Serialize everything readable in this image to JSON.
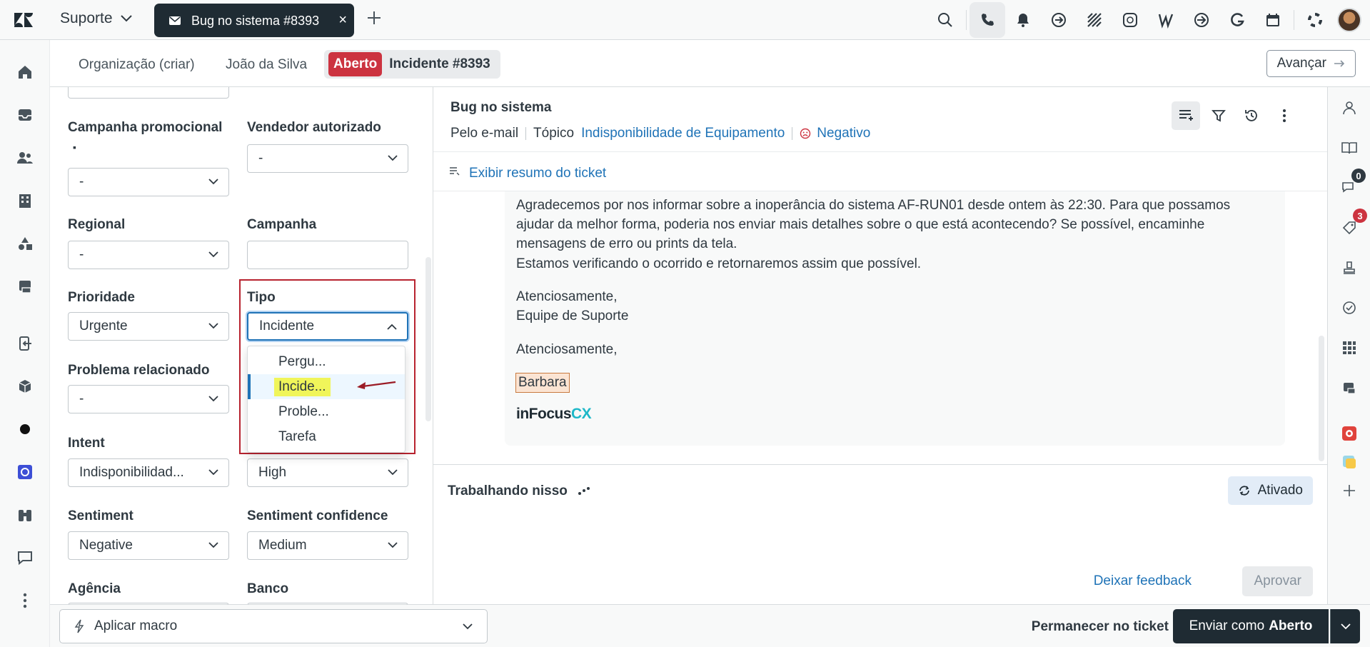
{
  "topbar": {
    "product": "Suporte",
    "tab_title": "Bug no sistema #8393",
    "tab_close": "×"
  },
  "breadcrumbs": {
    "organization": "Organização (criar)",
    "requester": "João da Silva",
    "status_badge": "Aberto",
    "ticket": "Incidente #8393",
    "next_button": "Avançar"
  },
  "form": {
    "campanha_promocional": {
      "label": "Campanha promocional",
      "required_marker": "▪",
      "value": "-"
    },
    "vendedor_autorizado": {
      "label": "Vendedor autorizado",
      "value": "-"
    },
    "regional": {
      "label": "Regional",
      "value": "-"
    },
    "campanha": {
      "label": "Campanha",
      "value": ""
    },
    "prioridade": {
      "label": "Prioridade",
      "value": "Urgente"
    },
    "tipo": {
      "label": "Tipo",
      "value": "Incidente",
      "options": [
        "Pergu...",
        "Incide...",
        "Proble...",
        "Tarefa"
      ],
      "selected_index": 1
    },
    "problema_relacionado": {
      "label": "Problema relacionado",
      "value": "-"
    },
    "intent": {
      "label": "Intent",
      "value": "Indisponibilidad..."
    },
    "intent_confidence": {
      "value": "High"
    },
    "sentiment": {
      "label": "Sentiment",
      "value": "Negative"
    },
    "sentiment_confidence": {
      "label": "Sentiment confidence",
      "value": "Medium"
    },
    "agencia": {
      "label": "Agência"
    },
    "banco": {
      "label": "Banco"
    }
  },
  "conversation": {
    "title": "Bug no sistema",
    "channel": "Pelo e-mail",
    "topic_label": "Tópico",
    "topic_value": "Indisponibilidade de Equipamento",
    "sentiment_value": "Negativo",
    "summary_link": "Exibir resumo do ticket",
    "message": {
      "p1": "Agradecemos por nos informar sobre a inoperância do sistema AF-RUN01 desde ontem às 22:30. Para que possamos ajudar da melhor forma, poderia nos enviar mais detalhes sobre o que está acontecendo? Se possível, encaminhe mensagens de erro ou prints da tela.",
      "p2": "Estamos verificando o ocorrido e retornaremos assim que possível.",
      "p3a": "Atenciosamente,",
      "p3b": "Equipe de Suporte",
      "p4": "Atenciosamente,",
      "signature_name": "Barbara",
      "logo_a": "inFocus",
      "logo_b": "CX"
    },
    "working": {
      "title": "Trabalhando nisso",
      "status_button": "Ativado",
      "feedback_link": "Deixar feedback",
      "approve_button": "Aprovar"
    }
  },
  "right_sidebar": {
    "badge_conversations": "0",
    "badge_alerts": "3"
  },
  "bottombar": {
    "macro": "Aplicar macro",
    "stay": "Permanecer no ticket",
    "submit_prefix": "Enviar como",
    "submit_status": "Aberto"
  },
  "colors": {
    "open_badge": "#cc3340",
    "link": "#1f73b7",
    "highlight": "#f0f55a",
    "annotation_red": "#b8232f",
    "dark": "#1f2b33"
  }
}
